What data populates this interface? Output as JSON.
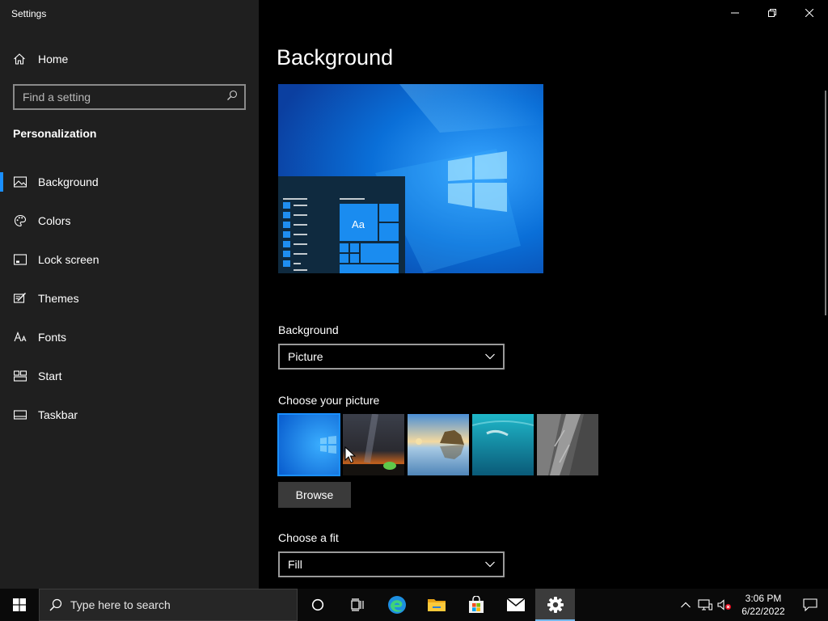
{
  "window": {
    "title": "Settings"
  },
  "sidebar": {
    "home_label": "Home",
    "search_placeholder": "Find a setting",
    "section_title": "Personalization",
    "items": [
      {
        "label": "Background",
        "icon": "picture-icon",
        "active": true
      },
      {
        "label": "Colors",
        "icon": "palette-icon",
        "active": false
      },
      {
        "label": "Lock screen",
        "icon": "lock-screen-icon",
        "active": false
      },
      {
        "label": "Themes",
        "icon": "themes-icon",
        "active": false
      },
      {
        "label": "Fonts",
        "icon": "fonts-icon",
        "active": false
      },
      {
        "label": "Start",
        "icon": "start-icon",
        "active": false
      },
      {
        "label": "Taskbar",
        "icon": "taskbar-icon",
        "active": false
      }
    ]
  },
  "main": {
    "title": "Background",
    "preview": {
      "sample_text": "Aa"
    },
    "background_label": "Background",
    "background_value": "Picture",
    "choose_picture_label": "Choose your picture",
    "pictures": [
      "windows-default",
      "night-sky",
      "beach-rocks",
      "underwater-swimmer",
      "rock-cliff"
    ],
    "selected_picture": "windows-default",
    "browse_label": "Browse",
    "fit_label": "Choose a fit",
    "fit_value": "Fill"
  },
  "taskbar": {
    "search_placeholder": "Type here to search",
    "apps": [
      "cortana-icon",
      "task-view-icon",
      "edge-icon",
      "file-explorer-icon",
      "store-icon",
      "mail-icon",
      "settings-icon"
    ],
    "active_app": "settings-icon",
    "time": "3:06 PM",
    "date": "6/22/2022"
  },
  "colors": {
    "accent": "#1a8fff",
    "sidebar_bg": "#1f1f1f",
    "main_bg": "#000000",
    "taskbar_bg": "#0a0a0a"
  }
}
